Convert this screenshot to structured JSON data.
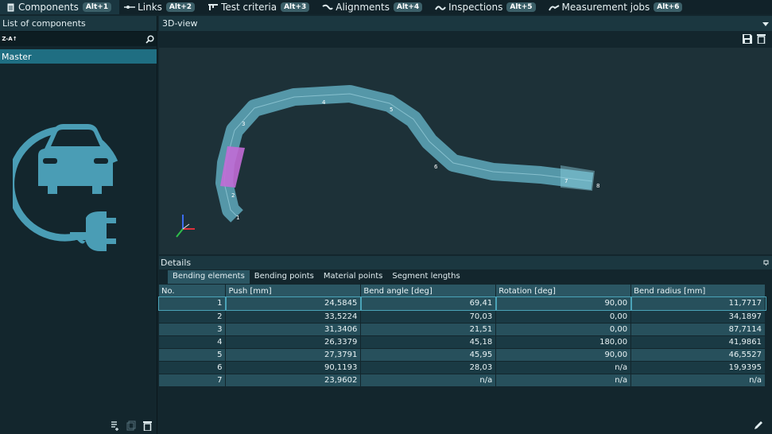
{
  "top_tabs": [
    {
      "label": "Components",
      "shortcut": "Alt+1"
    },
    {
      "label": "Links",
      "shortcut": "Alt+2"
    },
    {
      "label": "Test criteria",
      "shortcut": "Alt+3"
    },
    {
      "label": "Alignments",
      "shortcut": "Alt+4"
    },
    {
      "label": "Inspections",
      "shortcut": "Alt+5"
    },
    {
      "label": "Measurement jobs",
      "shortcut": "Alt+6"
    }
  ],
  "left_panel": {
    "title": "List of components",
    "sort_label": "Z-A↑",
    "search_value": "",
    "selected_item": "Master"
  },
  "view": {
    "title": "3D-view",
    "point_labels": [
      "1",
      "2",
      "3",
      "4",
      "5",
      "6",
      "7",
      "8"
    ]
  },
  "details": {
    "title": "Details",
    "tabs": [
      "Bending elements",
      "Bending points",
      "Material points",
      "Segment lengths"
    ],
    "columns": [
      "No.",
      "Push [mm]",
      "Bend angle [deg]",
      "Rotation [deg]",
      "Bend radius [mm]"
    ],
    "rows": [
      [
        "1",
        "24,5845",
        "69,41",
        "90,00",
        "11,7717"
      ],
      [
        "2",
        "33,5224",
        "70,03",
        "0,00",
        "34,1897"
      ],
      [
        "3",
        "31,3406",
        "21,51",
        "0,00",
        "87,7114"
      ],
      [
        "4",
        "26,3379",
        "45,18",
        "180,00",
        "41,9861"
      ],
      [
        "5",
        "27,3791",
        "45,95",
        "90,00",
        "46,5527"
      ],
      [
        "6",
        "90,1193",
        "28,03",
        "n/a",
        "19,9395"
      ],
      [
        "7",
        "23,9602",
        "n/a",
        "n/a",
        "n/a"
      ]
    ]
  },
  "colors": {
    "accent": "#1f6e82",
    "tube": "#6fc3d6",
    "highlight": "#c26bd6"
  }
}
